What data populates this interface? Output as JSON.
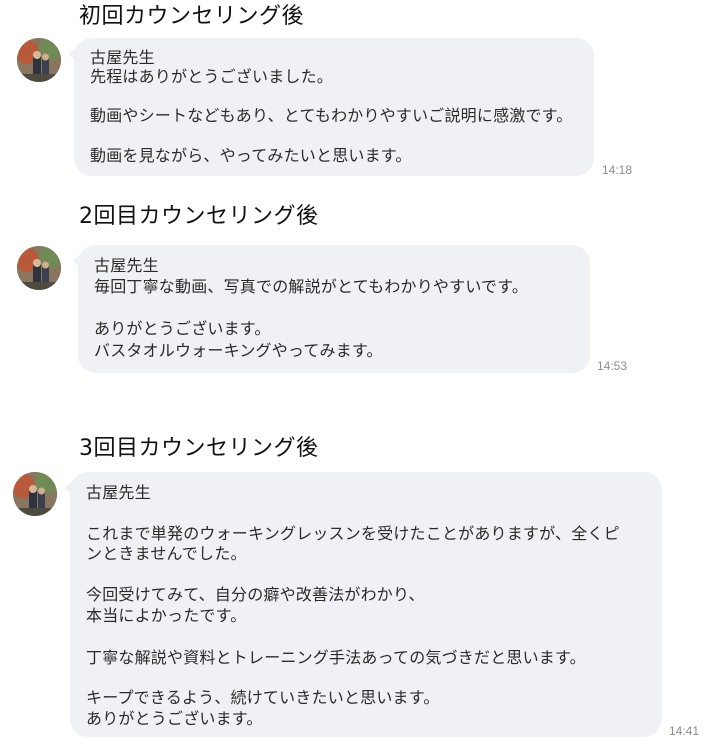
{
  "sections": [
    {
      "heading": "初回カウンセリング後",
      "sender": "古屋先生",
      "lines": [
        "先程はありがとうございました。",
        "動画やシートなどもあり、とてもわかりやすいご説明に感激です。",
        "動画を見ながら、やってみたいと思います。"
      ],
      "time": "14:18"
    },
    {
      "heading": "2回目カウンセリング後",
      "sender": "古屋先生",
      "lines": [
        "毎回丁寧な動画、写真での解説がとてもわかりやすいです。",
        "ありがとうございます。",
        "バスタオルウォーキングやってみます。"
      ],
      "time": "14:53"
    },
    {
      "heading": "3回目カウンセリング後",
      "sender": "古屋先生",
      "lines": [
        "これまで単発のウォーキングレッスンを受けたことがありますが、全くピ",
        "ンときませんでした。",
        "今回受けてみて、自分の癖や改善法がわかり、",
        "本当によかったです。",
        "丁寧な解説や資料とトレーニング手法あっての気づきだと思います。",
        "キープできるよう、続けていきたいと思います。",
        "ありがとうございます。"
      ],
      "time": "14:41"
    }
  ]
}
